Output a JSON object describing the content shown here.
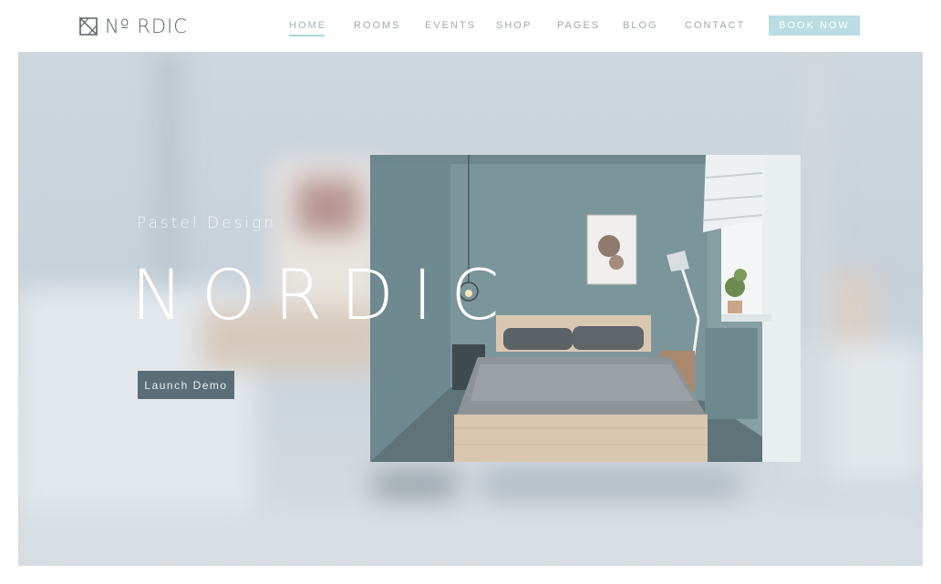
{
  "header": {
    "logo_text": "Nº RDIC",
    "nav": [
      {
        "label": "HOME",
        "active": true
      },
      {
        "label": "ROOMS",
        "active": false
      },
      {
        "label": "EVENTS",
        "active": false
      },
      {
        "label": "SHOP",
        "active": false
      },
      {
        "label": "PAGES",
        "active": false
      },
      {
        "label": "BLOG",
        "active": false
      },
      {
        "label": "CONTACT",
        "active": false
      }
    ],
    "book_label": "BOOK NOW"
  },
  "hero": {
    "subtitle": "Pastel Design",
    "title": "NORDIC",
    "button_label": "Launch Demo"
  },
  "colors": {
    "accent": "#b9dde2",
    "active_underline": "#a8d8d8",
    "button_dark": "#5b6e78",
    "wall": "#7c979c"
  },
  "icons": {
    "logo": "nordic-logo-icon"
  }
}
